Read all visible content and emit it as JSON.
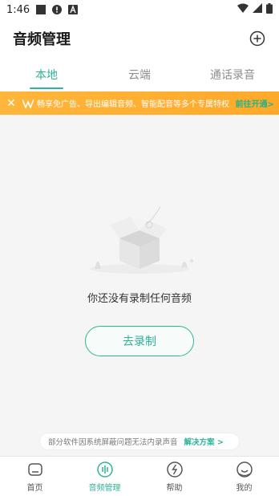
{
  "status_bar": {
    "time": "1:46",
    "icons": [
      "square-icon",
      "alert-icon",
      "a-icon",
      "wifi-icon",
      "signal-icon",
      "battery-icon"
    ]
  },
  "header": {
    "title": "音频管理",
    "add_icon": "plus-circle-icon"
  },
  "tabs": [
    {
      "label": "本地",
      "active": true
    },
    {
      "label": "云端",
      "active": false
    },
    {
      "label": "通话录音",
      "active": false
    }
  ],
  "banner": {
    "close": "✕",
    "text": "畅享免广告、导出编辑音频、智能配音等多个专属特权",
    "cta": "前往开通>"
  },
  "empty_state": {
    "message": "你还没有录制任何音频",
    "button": "去录制"
  },
  "notice": {
    "text": "部分软件因系统屏蔽问题无法内录声音",
    "link": "解决方案 >"
  },
  "bottom_nav": [
    {
      "label": "首页",
      "icon": "home-icon",
      "active": false
    },
    {
      "label": "音频管理",
      "icon": "audio-icon",
      "active": true
    },
    {
      "label": "帮助",
      "icon": "help-icon",
      "active": false
    },
    {
      "label": "我的",
      "icon": "profile-icon",
      "active": false
    }
  ],
  "colors": {
    "accent": "#2fb496",
    "banner": "#ffb63a"
  }
}
